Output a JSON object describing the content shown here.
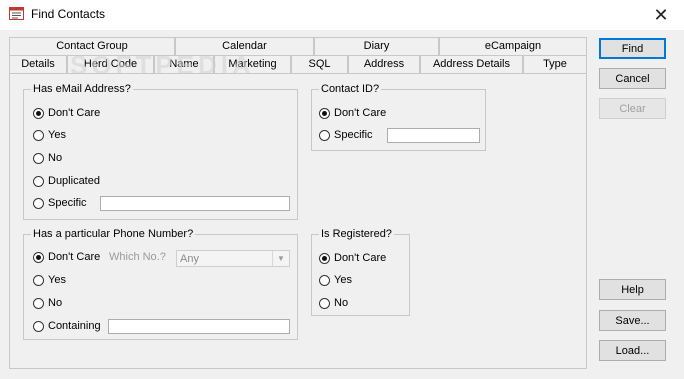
{
  "window": {
    "title": "Find Contacts",
    "close_glyph": "✕"
  },
  "watermark": "SOFTPEDIA",
  "tabs": {
    "back_row": [
      "Contact Group",
      "Calendar",
      "Diary",
      "eCampaign"
    ],
    "front_row": [
      "Details",
      "Herd Code",
      "Name",
      "Marketing",
      "SQL",
      "Address",
      "Address Details",
      "Type"
    ],
    "active": "Details"
  },
  "email_group": {
    "title": "Has eMail Address?",
    "options": [
      "Don't Care",
      "Yes",
      "No",
      "Duplicated",
      "Specific"
    ],
    "selected": "Don't Care",
    "specific_value": ""
  },
  "contact_id_group": {
    "title": "Contact ID?",
    "options": [
      "Don't Care",
      "Specific"
    ],
    "selected": "Don't Care",
    "specific_value": ""
  },
  "phone_group": {
    "title": "Has a particular Phone Number?",
    "options": [
      "Don't Care",
      "Yes",
      "No",
      "Containing"
    ],
    "selected": "Don't Care",
    "which_no_label": "Which No.?",
    "which_no_value": "Any",
    "containing_value": ""
  },
  "registered_group": {
    "title": "Is Registered?",
    "options": [
      "Don't Care",
      "Yes",
      "No"
    ],
    "selected": "Don't Care"
  },
  "buttons": {
    "find": "Find",
    "cancel": "Cancel",
    "clear": "Clear",
    "help": "Help",
    "save": "Save...",
    "load": "Load..."
  }
}
